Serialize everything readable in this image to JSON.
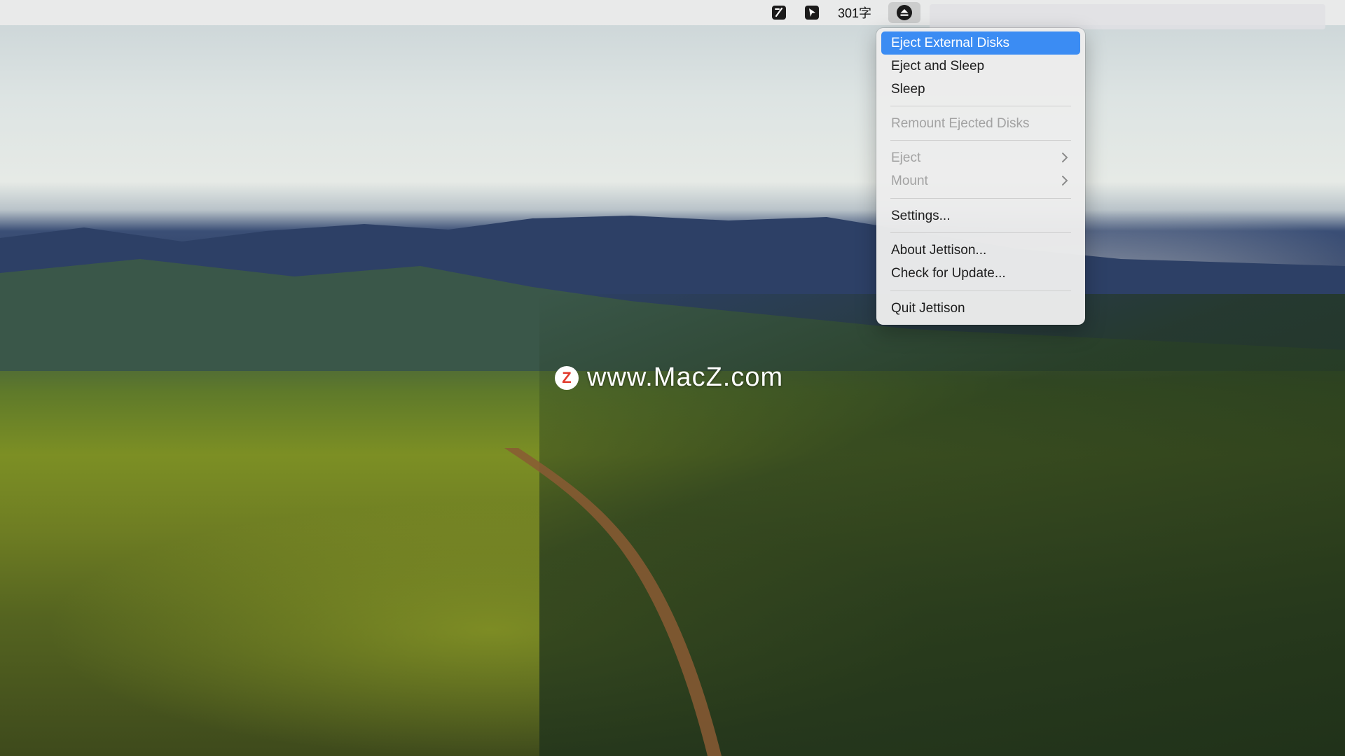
{
  "menubar": {
    "icons": [
      "notes-app-icon",
      "cursor-app-icon",
      "eject-menu-icon"
    ],
    "word_count": "301字"
  },
  "menu": {
    "eject_external": "Eject External Disks",
    "eject_sleep": "Eject and Sleep",
    "sleep": "Sleep",
    "remount": "Remount Ejected Disks",
    "eject_sub": "Eject",
    "mount_sub": "Mount",
    "settings": "Settings...",
    "about": "About Jettison...",
    "check_update": "Check for Update...",
    "quit": "Quit Jettison"
  },
  "watermark": {
    "badge": "Z",
    "text": "www.MacZ.com"
  },
  "colors": {
    "highlight": "#3b8cf3",
    "menu_bg": "#ececec",
    "disabled_text": "#a2a2a2"
  }
}
